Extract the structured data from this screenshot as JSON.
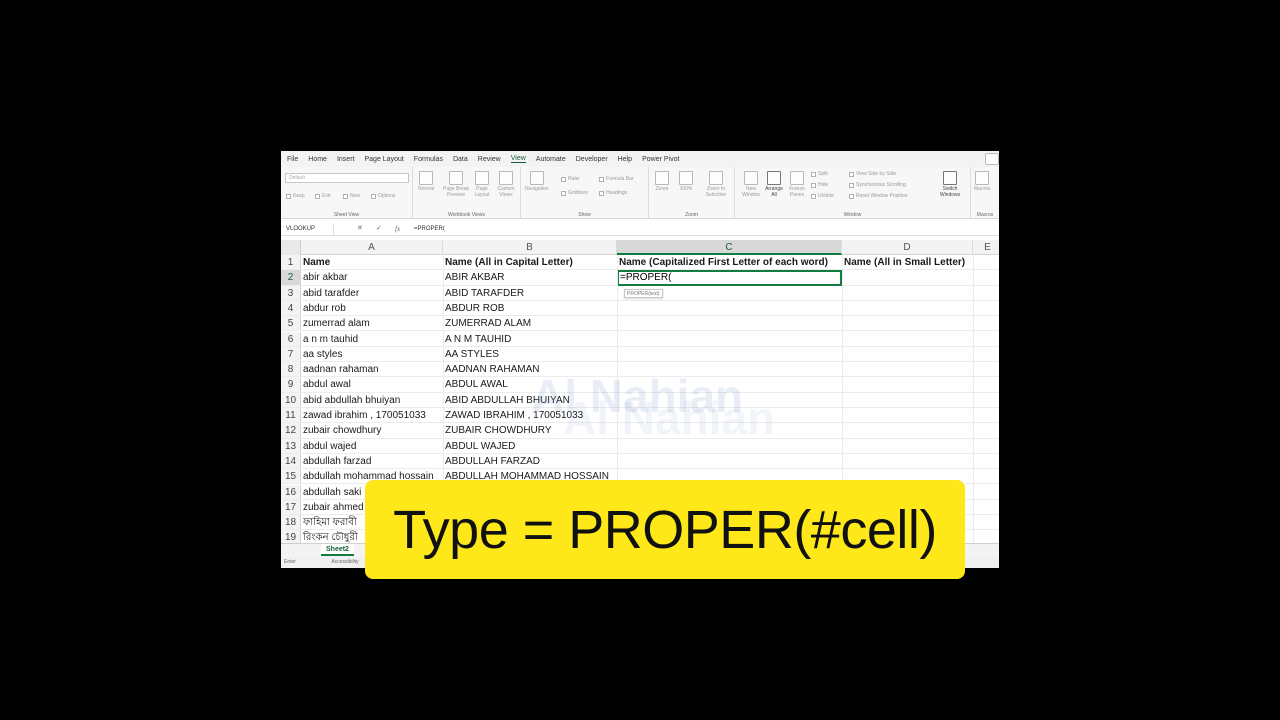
{
  "ribbon": {
    "tabs": [
      "File",
      "Home",
      "Insert",
      "Page Layout",
      "Formulas",
      "Data",
      "Review",
      "View",
      "Automate",
      "Developer",
      "Help",
      "Power Pivot"
    ],
    "active_tab": "View",
    "sheet_view": {
      "combo": "Default",
      "buttons": [
        "Keep",
        "Exit",
        "New",
        "Options"
      ],
      "label": "Sheet View"
    },
    "workbook_views": {
      "buttons": [
        "Normal",
        "Page Break Preview",
        "Page Layout",
        "Custom Views"
      ],
      "label": "Workbook Views"
    },
    "show": {
      "navigation": "Navigation",
      "checks": [
        "Ruler",
        "Formula Bar",
        "Gridlines",
        "Headings"
      ],
      "label": "Show"
    },
    "zoom": {
      "buttons": [
        "Zoom",
        "100%",
        "Zoom to Selection"
      ],
      "label": "Zoom"
    },
    "window": {
      "buttons": [
        "New Window",
        "Arrange All",
        "Freeze Panes"
      ],
      "small": [
        "Split",
        "Hide",
        "Unhide"
      ],
      "sync": [
        "View Side by Side",
        "Synchronous Scrolling",
        "Reset Window Position"
      ],
      "switch": "Switch Windows",
      "label": "Window"
    },
    "macros": {
      "button": "Macros",
      "label": "Macros"
    }
  },
  "formula_bar": {
    "name_box": "VLOOKUP",
    "content": "=PROPER("
  },
  "columns": [
    "A",
    "B",
    "C",
    "D",
    "E"
  ],
  "active_column": "C",
  "active_row": 2,
  "rows": [
    {
      "num": "1",
      "a": "Name",
      "b": "Name (All in Capital Letter)",
      "c": "Name (Capitalized First Letter of each word)",
      "d": "Name (All in Small Letter)"
    },
    {
      "num": "2",
      "a": "abir akbar",
      "b": "ABIR AKBAR",
      "c": "",
      "d": ""
    },
    {
      "num": "3",
      "a": "abid tarafder",
      "b": "ABID TARAFDER",
      "c": "",
      "d": ""
    },
    {
      "num": "4",
      "a": "abdur rob",
      "b": "ABDUR ROB",
      "c": "",
      "d": ""
    },
    {
      "num": "5",
      "a": "zumerrad alam",
      "b": "ZUMERRAD ALAM",
      "c": "",
      "d": ""
    },
    {
      "num": "6",
      "a": "a n m tauhid",
      "b": "A N M TAUHID",
      "c": "",
      "d": ""
    },
    {
      "num": "7",
      "a": "aa styles",
      "b": "AA STYLES",
      "c": "",
      "d": ""
    },
    {
      "num": "8",
      "a": "aadnan rahaman",
      "b": "AADNAN RAHAMAN",
      "c": "",
      "d": ""
    },
    {
      "num": "9",
      "a": "abdul awal",
      "b": "ABDUL AWAL",
      "c": "",
      "d": ""
    },
    {
      "num": "10",
      "a": "abid abdullah bhuiyan",
      "b": "ABID ABDULLAH BHUIYAN",
      "c": "",
      "d": ""
    },
    {
      "num": "11",
      "a": "zawad ibrahim , 170051033",
      "b": "ZAWAD IBRAHIM , 170051033",
      "c": "",
      "d": ""
    },
    {
      "num": "12",
      "a": "zubair chowdhury",
      "b": "ZUBAIR CHOWDHURY",
      "c": "",
      "d": ""
    },
    {
      "num": "13",
      "a": "abdul wajed",
      "b": "ABDUL WAJED",
      "c": "",
      "d": ""
    },
    {
      "num": "14",
      "a": "abdullah farzad",
      "b": "ABDULLAH FARZAD",
      "c": "",
      "d": ""
    },
    {
      "num": "15",
      "a": "abdullah mohammad hossain",
      "b": "ABDULLAH MOHAMMAD HOSSAIN",
      "c": "",
      "d": ""
    },
    {
      "num": "16",
      "a": "abdullah saki",
      "b": "",
      "c": "",
      "d": ""
    },
    {
      "num": "17",
      "a": "zubair ahmed",
      "b": "",
      "c": "",
      "d": ""
    },
    {
      "num": "18",
      "a": "ফাহিমা ফরাবী",
      "b": "",
      "c": "",
      "d": ""
    },
    {
      "num": "19",
      "a": "রিংকন চৌধুরী",
      "b": "",
      "c": "",
      "d": ""
    }
  ],
  "active_cell": {
    "value": "=PROPER(",
    "tooltip": "PROPER(text)"
  },
  "sheet_tab": "Sheet2",
  "status": {
    "mode": "Enter",
    "accessibility": "Accessibility"
  },
  "watermark": "Al Nahian",
  "caption": "Type = PROPER(#cell)",
  "colors": {
    "excel_green": "#107c41",
    "caption_bg": "#ffe81a"
  }
}
